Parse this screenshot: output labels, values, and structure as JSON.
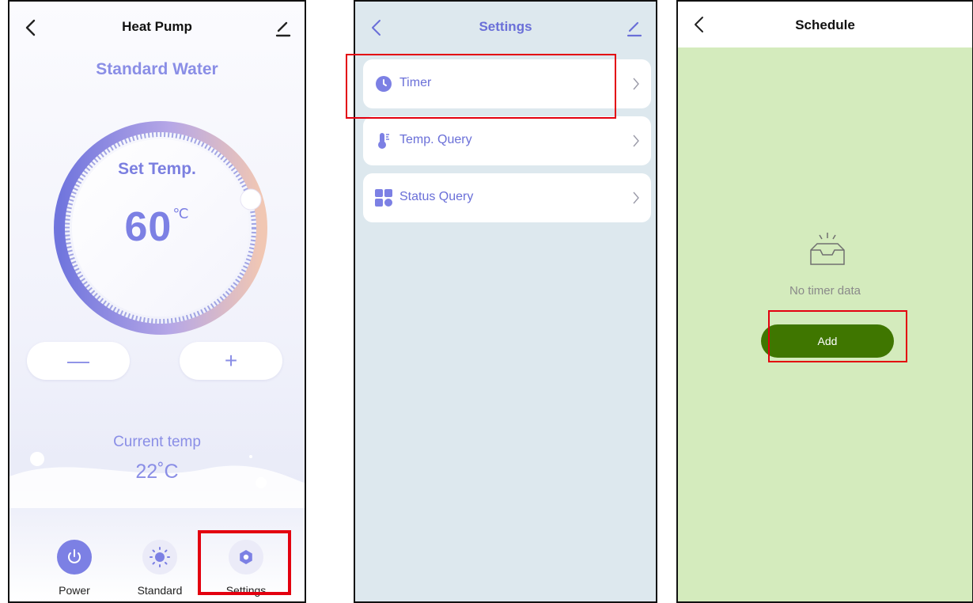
{
  "screen1": {
    "title": "Heat Pump",
    "mode_title": "Standard Water",
    "set_temp_label": "Set Temp.",
    "set_temp_value": "60",
    "set_temp_unit": "℃",
    "minus_label": "—",
    "plus_label": "+",
    "current_temp_label": "Current temp",
    "current_temp_value": "22˚C",
    "tabs": [
      {
        "label": "Power",
        "icon": "power-icon"
      },
      {
        "label": "Standard",
        "icon": "sun-icon"
      },
      {
        "label": "Settings",
        "icon": "gear-icon"
      }
    ],
    "colors": {
      "accent": "#8a8ee6",
      "highlight": "#e3000f"
    }
  },
  "screen2": {
    "title": "Settings",
    "items": [
      {
        "label": "Timer",
        "icon": "clock-icon"
      },
      {
        "label": "Temp. Query",
        "icon": "thermometer-icon"
      },
      {
        "label": "Status Query",
        "icon": "grid-icon"
      }
    ]
  },
  "screen3": {
    "title": "Schedule",
    "empty_text": "No timer data",
    "add_label": "Add",
    "colors": {
      "background": "#d4ebbd",
      "button": "#3f7600"
    }
  }
}
